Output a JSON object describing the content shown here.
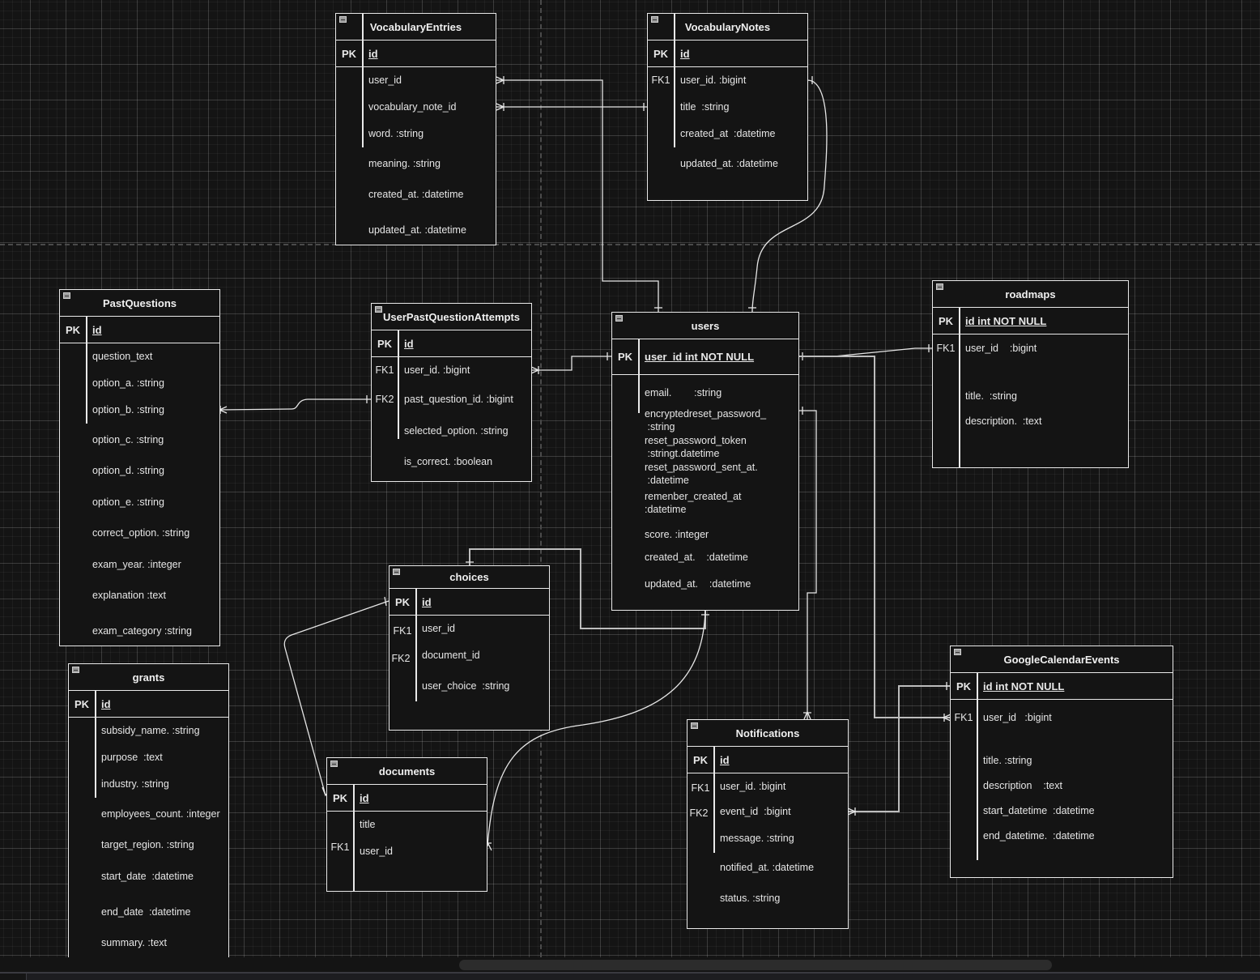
{
  "diagram": {
    "type": "ER diagram",
    "theme_background": "#141414",
    "line_color": "#e6e6e6",
    "entities": {
      "vocabulary_entries": {
        "title": "VocabularyEntries",
        "pk_label": "PK",
        "pk_name": "id",
        "key_labels": [],
        "attributes": [
          "user_id",
          "vocabulary_note_id",
          "word. :string",
          "meaning. :string",
          "created_at. :datetime",
          "updated_at. :datetime"
        ]
      },
      "vocabulary_notes": {
        "title": "VocabularyNotes",
        "pk_label": "PK",
        "pk_name": "id",
        "key_labels": [
          "FK1"
        ],
        "attributes": [
          "user_id. :bigint",
          "title  :string",
          "created_at  :datetime",
          "updated_at. :datetime"
        ]
      },
      "past_questions": {
        "title": "PastQuestions",
        "pk_label": "PK",
        "pk_name": "id",
        "key_labels": [],
        "attributes": [
          "question_text",
          "option_a. :string",
          "option_b. :string",
          "option_c. :string",
          "option_d. :string",
          "option_e. :string",
          "correct_option. :string",
          "exam_year. :integer",
          "explanation :text",
          "exam_category :string"
        ]
      },
      "user_past_question_attempts": {
        "title": "UserPastQuestionAttempts",
        "pk_label": "PK",
        "pk_name": "id",
        "key_labels": [
          "FK1",
          "FK2"
        ],
        "attributes": [
          "user_id. :bigint",
          "past_question_id. :bigint",
          "selected_option. :string",
          "is_correct. :boolean"
        ]
      },
      "users": {
        "title": "users",
        "pk_label": "PK",
        "pk_name": "user_id int NOT NULL",
        "key_labels": [],
        "attributes": [
          "email.        :string",
          "encryptedreset_password_",
          " :string",
          "reset_password_token",
          " :stringt.datetime",
          "reset_password_sent_at.",
          " :datetime",
          "remenber_created_at",
          ":datetime",
          "score. :integer",
          "created_at.    :datetime",
          "updated_at.    :datetime"
        ]
      },
      "roadmaps": {
        "title": "roadmaps",
        "pk_label": "PK",
        "pk_name": "id int NOT NULL",
        "key_labels": [
          "FK1"
        ],
        "attributes": [
          "user_id    :bigint",
          "title.  :string",
          "description.  :text"
        ]
      },
      "choices": {
        "title": "choices",
        "pk_label": "PK",
        "pk_name": "id",
        "key_labels": [
          "FK1",
          "FK2"
        ],
        "attributes": [
          "user_id",
          "document_id",
          "user_choice  :string"
        ]
      },
      "grants": {
        "title": "grants",
        "pk_label": "PK",
        "pk_name": "id",
        "key_labels": [],
        "attributes": [
          "subsidy_name. :string",
          "purpose  :text",
          "industry. :string",
          "employees_count. :integer",
          "target_region. :string",
          "start_date  :datetime",
          "end_date  :datetime",
          "summary. :text"
        ]
      },
      "documents": {
        "title": "documents",
        "pk_label": "PK",
        "pk_name": "id",
        "key_labels": [
          "FK1"
        ],
        "attributes": [
          "title",
          "user_id"
        ]
      },
      "notifications": {
        "title": "Notifications",
        "pk_label": "PK",
        "pk_name": "id",
        "key_labels": [
          "FK1",
          "FK2"
        ],
        "attributes": [
          "user_id. :bigint",
          "event_id  :bigint",
          "message. :string",
          "notified_at. :datetime",
          "status. :string"
        ]
      },
      "google_calendar_events": {
        "title": "GoogleCalendarEvents",
        "pk_label": "PK",
        "pk_name": "id int NOT NULL",
        "key_labels": [
          "FK1"
        ],
        "attributes": [
          "user_id   :bigint",
          "title. :string",
          "description    :text",
          "start_datetime  :datetime",
          "end_datetime.  :datetime"
        ]
      }
    },
    "relationships": [
      {
        "from": "users",
        "to": "vocabulary_entries",
        "to_field": "user_id",
        "cardinality": "one-to-many"
      },
      {
        "from": "vocabulary_notes",
        "to": "vocabulary_entries",
        "to_field": "vocabulary_note_id",
        "cardinality": "one-to-many"
      },
      {
        "from": "users",
        "to": "vocabulary_notes",
        "to_field": "user_id",
        "cardinality": "one-to-one"
      },
      {
        "from": "users",
        "to": "user_past_question_attempts",
        "to_field": "user_id",
        "cardinality": "one-to-many"
      },
      {
        "from": "past_questions",
        "to": "user_past_question_attempts",
        "to_field": "past_question_id",
        "cardinality": "one-to-many"
      },
      {
        "from": "users",
        "to": "roadmaps",
        "to_field": "user_id",
        "cardinality": "one-to-one"
      },
      {
        "from": "users",
        "to": "google_calendar_events",
        "to_field": "user_id",
        "cardinality": "one-to-many"
      },
      {
        "from": "users",
        "to": "notifications",
        "to_field": "user_id",
        "cardinality": "one-to-many"
      },
      {
        "from": "google_calendar_events",
        "to": "notifications",
        "to_field": "event_id",
        "cardinality": "one-to-many"
      },
      {
        "from": "users",
        "to": "choices",
        "to_field": "user_id",
        "cardinality": "one-to-one"
      },
      {
        "from": "users",
        "to": "documents",
        "to_field": "user_id",
        "cardinality": "one-to-many"
      },
      {
        "from": "choices",
        "to": "documents",
        "to_field": "id",
        "cardinality": "many-to-many"
      }
    ]
  }
}
